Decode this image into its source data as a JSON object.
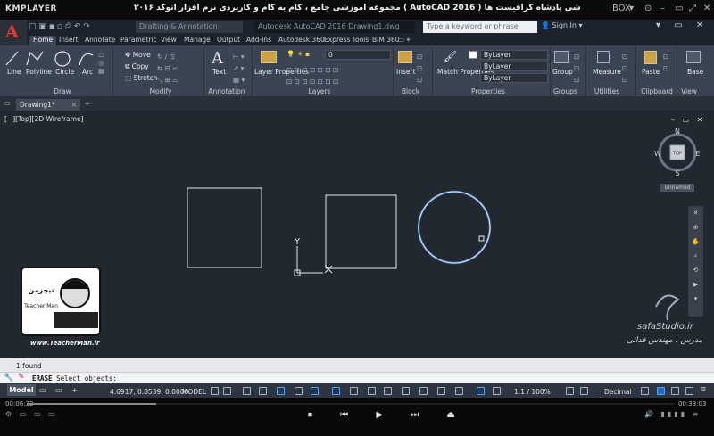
{
  "player": {
    "logo": "KMPLAYER",
    "caption": "مجموعه آموزشی جامع ، گام به گام و کاربردی نرم افزار  اتوکد ۲۰۱۶ ( AutoCAD  2016 )  مدرس : سعید فدایی (تیچرمن ) گروه آموزشی پادشاه گرافیست ها",
    "box_label": "BOX",
    "time_elapsed": "00:06:32",
    "time_total": "00:33:03",
    "progress": 0.2
  },
  "acad": {
    "app_letter": "A",
    "workspace": "Drafting & Annotation",
    "doc_title": "Autodesk AutoCAD 2016   Drawing1.dwg",
    "search_placeholder": "Type a keyword or phrase",
    "sign_in": "Sign In",
    "tabs": [
      "Home",
      "Insert",
      "Annotate",
      "Parametric",
      "View",
      "Manage",
      "Output",
      "Add-ins",
      "Autodesk 360",
      "Express Tools",
      "BIM 360"
    ]
  },
  "ribbon": {
    "draw": {
      "label": "Draw",
      "tools": [
        "Line",
        "Polyline",
        "Circle",
        "Arc"
      ]
    },
    "modify": {
      "label": "Modify",
      "tools": [
        "Move",
        "Copy",
        "Stretch"
      ]
    },
    "annotation": {
      "label": "Annotation",
      "tools": [
        "Text"
      ]
    },
    "layers": {
      "label": "Layers",
      "tools": [
        "Layer Properties"
      ],
      "current": "0"
    },
    "block": {
      "label": "Block",
      "tools": [
        "Insert"
      ]
    },
    "properties": {
      "label": "Properties",
      "tools": [
        "Match Properties"
      ],
      "color": "ByLayer",
      "linetype": "ByLayer",
      "lineweight": "ByLayer"
    },
    "groups": {
      "label": "Groups",
      "tools": [
        "Group"
      ]
    },
    "utilities": {
      "label": "Utilities",
      "tools": [
        "Measure"
      ]
    },
    "clipboard": {
      "label": "Clipboard",
      "tools": [
        "Paste"
      ]
    },
    "view": {
      "label": "View",
      "tools": [
        "Base"
      ]
    }
  },
  "file_tab": "Drawing1*",
  "viewport": {
    "label": "[−][Top][2D Wireframe]",
    "viewcube_face": "TOP",
    "compass": {
      "n": "N",
      "s": "S",
      "e": "E",
      "w": "W"
    },
    "ucs_name": "Unnamed",
    "ucs_axis_y": "Y"
  },
  "command": {
    "history": "1 found",
    "command_name": "ERASE",
    "prompt": "Select objects:"
  },
  "status": {
    "tab_model": "Model",
    "coords": "4.6917, 0.8539, 0.0000",
    "model": "MODEL",
    "scale": "1:1 / 100%",
    "units": "Decimal"
  },
  "watermarks": {
    "teacherman_url": "www.TeacherMan.ir",
    "teacherman_badge": "تیچرمن",
    "teacherman_sub": "Teacher Man",
    "safa": "safaStudio.ir",
    "safa_sub": "مدرس : مهندس فدائی"
  },
  "colors": {
    "accent": "#e53b31",
    "viewport": "#212830",
    "selection": "#6fa8ff"
  }
}
